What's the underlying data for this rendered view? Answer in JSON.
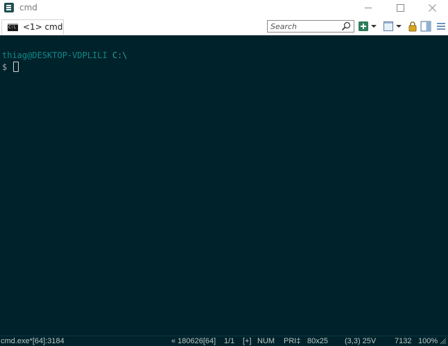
{
  "window": {
    "title": "cmd"
  },
  "tabs": [
    {
      "label": "<1> cmd"
    }
  ],
  "search": {
    "placeholder": "Search",
    "value": ""
  },
  "toolbar": {
    "icons": [
      "new-console-icon",
      "dropdown-arrow-icon",
      "view-icon",
      "dropdown-arrow-icon",
      "lock-icon",
      "split-view-icon",
      "hamburger-menu-icon"
    ]
  },
  "console": {
    "prompt_user": "thiag@DESKTOP-VDPLILI",
    "prompt_path": "C:\\",
    "prompt_symbol": "$"
  },
  "status": {
    "process": "cmd.exe*[64]:3184",
    "session": "« 180626[64]",
    "pane": "1/1",
    "plus": "[+]",
    "num": "NUM",
    "pri": "PRI‡",
    "size": "80x25",
    "cursor": "(3,3) 25V",
    "pid": "7132",
    "zoom": "100%"
  },
  "colors": {
    "console_bg": "#00222a",
    "prompt_user": "#0e8a8a",
    "prompt_path": "#2aa198",
    "accent_green": "#2e8b57"
  }
}
